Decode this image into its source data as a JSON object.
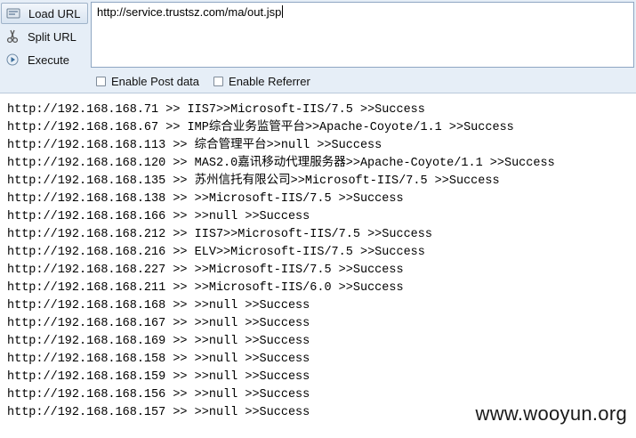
{
  "toolbar": {
    "load_url_label": "Load URL",
    "split_url_label": "Split URL",
    "execute_label": "Execute",
    "url_value": "http://service.trustsz.com/ma/out.jsp",
    "enable_post_label": "Enable Post data",
    "enable_referrer_label": "Enable Referrer"
  },
  "output": {
    "lines": [
      "http://192.168.168.71 >> IIS7>>Microsoft-IIS/7.5 >>Success",
      "http://192.168.168.67 >> IMP综合业务监管平台>>Apache-Coyote/1.1 >>Success",
      "http://192.168.168.113 >> 综合管理平台>>null >>Success",
      "http://192.168.168.120 >> MAS2.0嘉讯移动代理服务器>>Apache-Coyote/1.1 >>Success",
      "http://192.168.168.135 >> 苏州信托有限公司>>Microsoft-IIS/7.5 >>Success",
      "http://192.168.168.138 >> >>Microsoft-IIS/7.5 >>Success",
      "http://192.168.168.166 >> >>null >>Success",
      "http://192.168.168.212 >> IIS7>>Microsoft-IIS/7.5 >>Success",
      "http://192.168.168.216 >> ELV>>Microsoft-IIS/7.5 >>Success",
      "http://192.168.168.227 >> >>Microsoft-IIS/7.5 >>Success",
      "http://192.168.168.211 >> >>Microsoft-IIS/6.0 >>Success",
      "http://192.168.168.168 >> >>null >>Success",
      "http://192.168.168.167 >> >>null >>Success",
      "http://192.168.168.169 >> >>null >>Success",
      "http://192.168.168.158 >> >>null >>Success",
      "http://192.168.168.159 >> >>null >>Success",
      "http://192.168.168.156 >> >>null >>Success",
      "http://192.168.168.157 >> >>null >>Success"
    ]
  },
  "watermark": "www.wooyun.org"
}
